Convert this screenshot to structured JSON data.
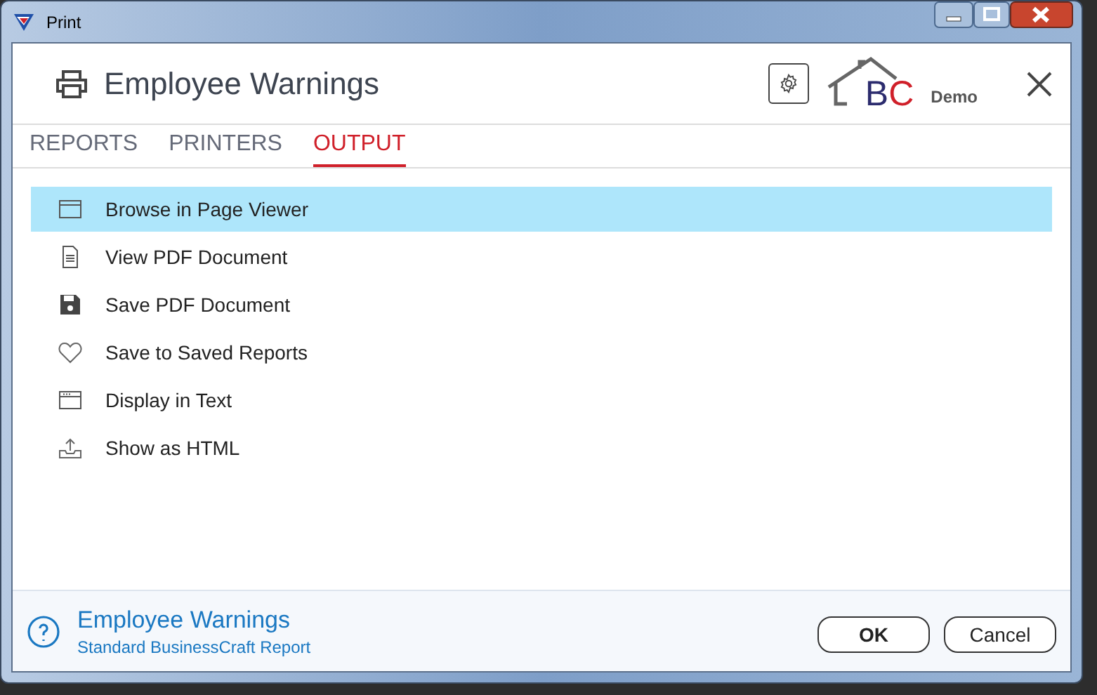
{
  "window": {
    "title": "Print"
  },
  "header": {
    "title": "Employee Warnings",
    "logo": {
      "letter_1": "B",
      "letter_2": "C",
      "edition": "Demo"
    }
  },
  "tabs": [
    {
      "label": "REPORTS",
      "selected": false
    },
    {
      "label": "PRINTERS",
      "selected": false
    },
    {
      "label": "OUTPUT",
      "selected": true
    }
  ],
  "output_options": [
    {
      "kind": "browser",
      "label": "Browse in Page Viewer",
      "selected": true
    },
    {
      "kind": "document",
      "label": "View PDF Document",
      "selected": false
    },
    {
      "kind": "save",
      "label": "Save PDF Document",
      "selected": false
    },
    {
      "kind": "heart",
      "label": "Save to Saved Reports",
      "selected": false
    },
    {
      "kind": "text",
      "label": "Display in Text",
      "selected": false
    },
    {
      "kind": "export",
      "label": "Show as HTML",
      "selected": false
    }
  ],
  "footer": {
    "title": "Employee Warnings",
    "subtitle": "Standard BusinessCraft Report",
    "buttons": [
      {
        "label": "OK",
        "default": true
      },
      {
        "label": "Cancel",
        "default": false
      }
    ]
  }
}
